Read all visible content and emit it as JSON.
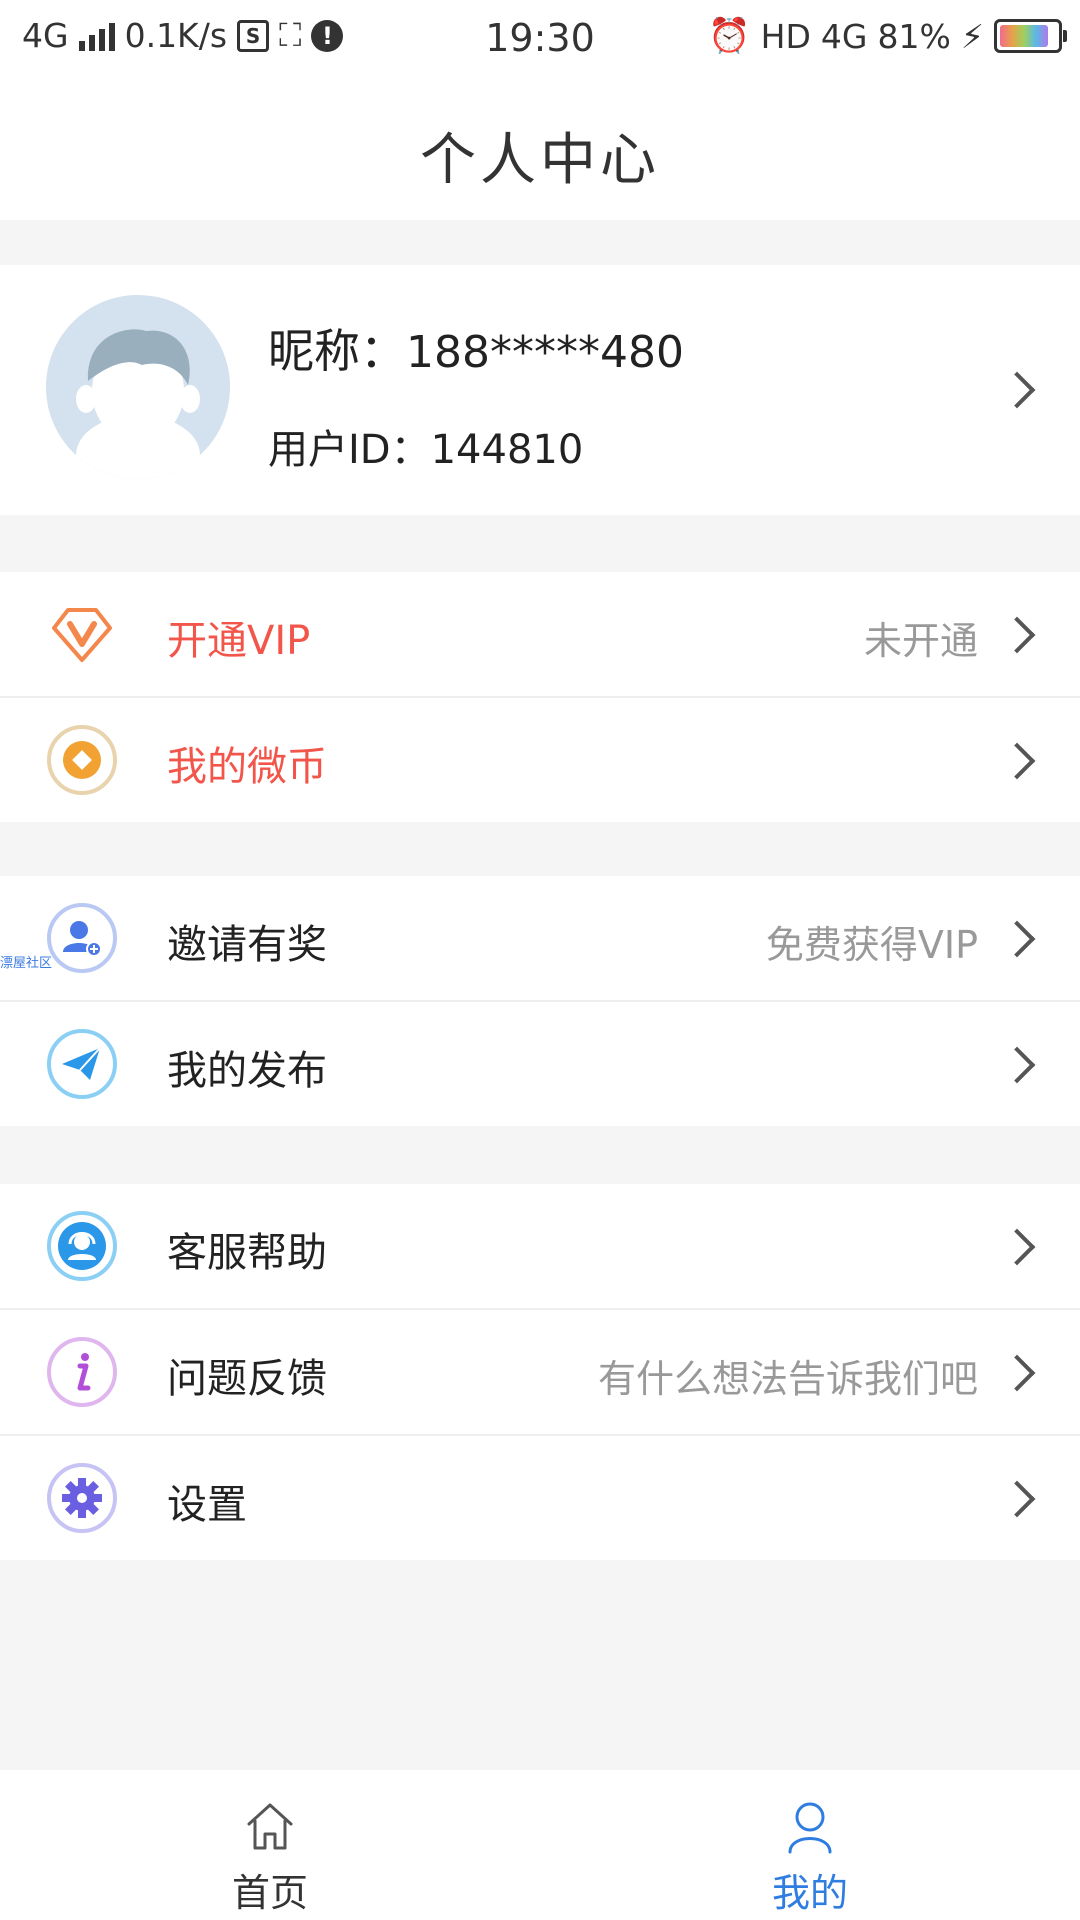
{
  "status_bar": {
    "network": "4G",
    "speed": "0.1K/s",
    "time": "19:30",
    "hd": "HD",
    "network2": "4G",
    "battery": "81%"
  },
  "header": {
    "title": "个人中心"
  },
  "profile": {
    "nickname_label": "昵称：",
    "nickname": "188*****480",
    "userid_label": "用户ID：",
    "userid": "144810"
  },
  "menu": {
    "vip": {
      "label": "开通VIP",
      "value": "未开通"
    },
    "coins": {
      "label": "我的微币"
    },
    "invite": {
      "label": "邀请有奖",
      "value": "免费获得VIP"
    },
    "posts": {
      "label": "我的发布"
    },
    "support": {
      "label": "客服帮助"
    },
    "feedback": {
      "label": "问题反馈",
      "value": "有什么想法告诉我们吧"
    },
    "settings": {
      "label": "设置"
    }
  },
  "watermark": "漂屋社区",
  "tabbar": {
    "home": "首页",
    "mine": "我的"
  },
  "colors": {
    "accent_blue": "#2f7de1",
    "accent_red": "#f2564b",
    "vip_orange": "#f4874b",
    "coin_gold": "#f1a233"
  }
}
